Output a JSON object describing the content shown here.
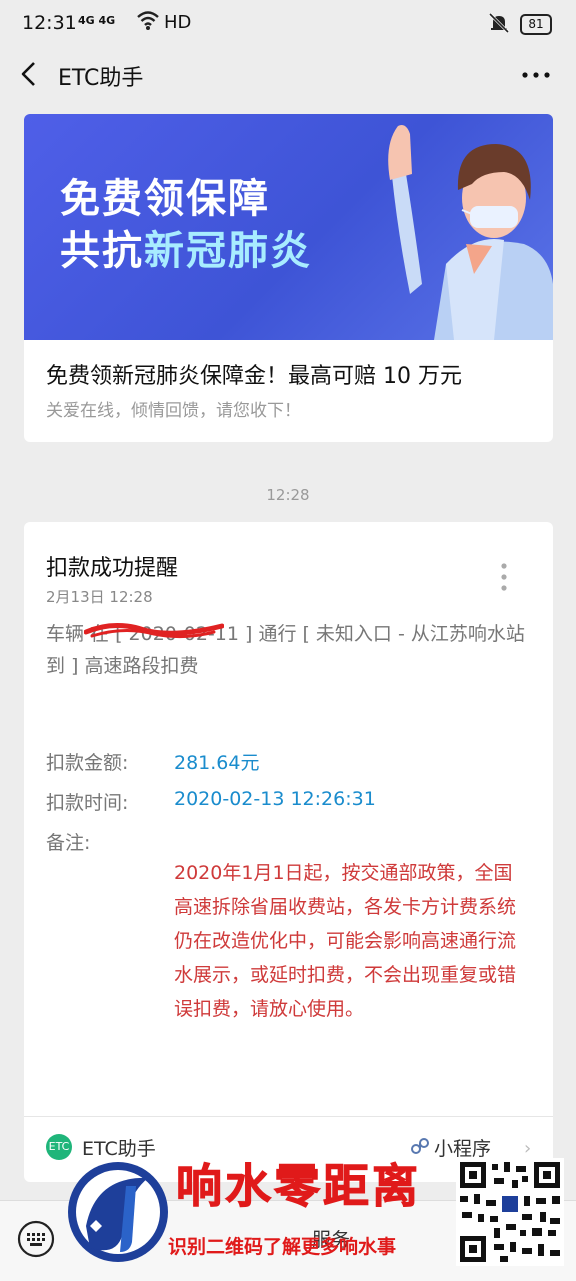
{
  "status_bar": {
    "time": "12:31",
    "signal": "4G 4G",
    "hd": "HD",
    "battery": "81"
  },
  "nav": {
    "title": "ETC助手"
  },
  "promo": {
    "banner_line1": "免费领保障",
    "banner_line2_a": "共抗",
    "banner_line2_b": "新冠肺炎",
    "title": "免费领新冠肺炎保障金！最高可赔 10 万元",
    "subtitle": "关爱在线，倾情回馈，请您收下！"
  },
  "time_separator": "12:28",
  "notice": {
    "title": "扣款成功提醒",
    "date": "2月13日  12:28",
    "description": "车辆                   在 [ 2020-02-11 ] 通行 [ 未知入口 - 从江苏响水站到 ] 高速路段扣费",
    "amount_label": "扣款金额:",
    "amount_value": "281.64元",
    "time_label": "扣款时间:",
    "time_value": "2020-02-13 12:26:31",
    "note_label": "备注:",
    "note_text": "2020年1月1日起，按交通部政策，全国高速拆除省届收费站，各发卡方计费系统仍在改造优化中，可能会影响高速通行流水展示，或延时扣费，不会出现重复或错误扣费，请放心使用。",
    "footer_logo": "ETC",
    "footer_name": "ETC助手",
    "footer_mini": "小程序"
  },
  "bottom_bar": {
    "menu_label": "服务"
  },
  "watermark": {
    "title": "响水零距离",
    "subtitle": "识别二维码了解更多响水事"
  },
  "colors": {
    "blue_value": "#1a8ccd",
    "red_note": "#cf3a3a",
    "banner": "#4a5ee6",
    "watermark_red": "#e01a1a"
  }
}
